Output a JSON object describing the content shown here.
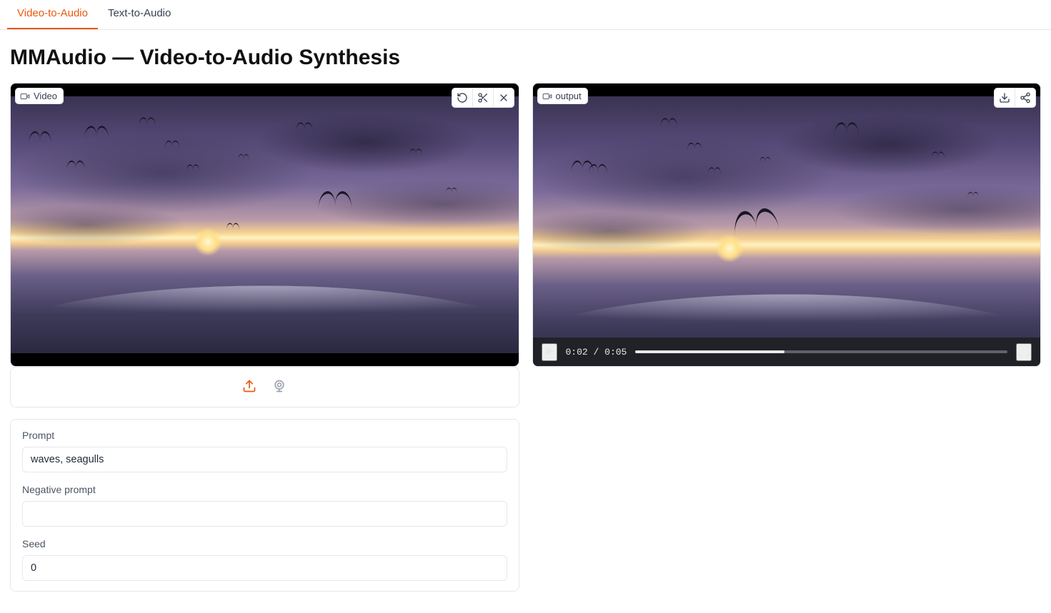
{
  "tabs": {
    "video_to_audio": "Video-to-Audio",
    "text_to_audio": "Text-to-Audio",
    "active": "video_to_audio"
  },
  "page_title": "MMAudio — Video-to-Audio Synthesis",
  "input_panel": {
    "label": "Video",
    "actions": [
      "undo",
      "trim",
      "clear"
    ]
  },
  "output_panel": {
    "label": "output",
    "actions": [
      "download",
      "share"
    ],
    "playback": {
      "current_time": "0:02",
      "duration": "0:05",
      "separator": "/",
      "progress_percent": 40
    }
  },
  "form": {
    "prompt_label": "Prompt",
    "prompt_value": "waves, seagulls",
    "neg_prompt_label": "Negative prompt",
    "neg_prompt_value": "",
    "seed_label": "Seed",
    "seed_value": "0"
  },
  "icons": {
    "upload": "upload-icon",
    "webcam": "webcam-icon"
  }
}
